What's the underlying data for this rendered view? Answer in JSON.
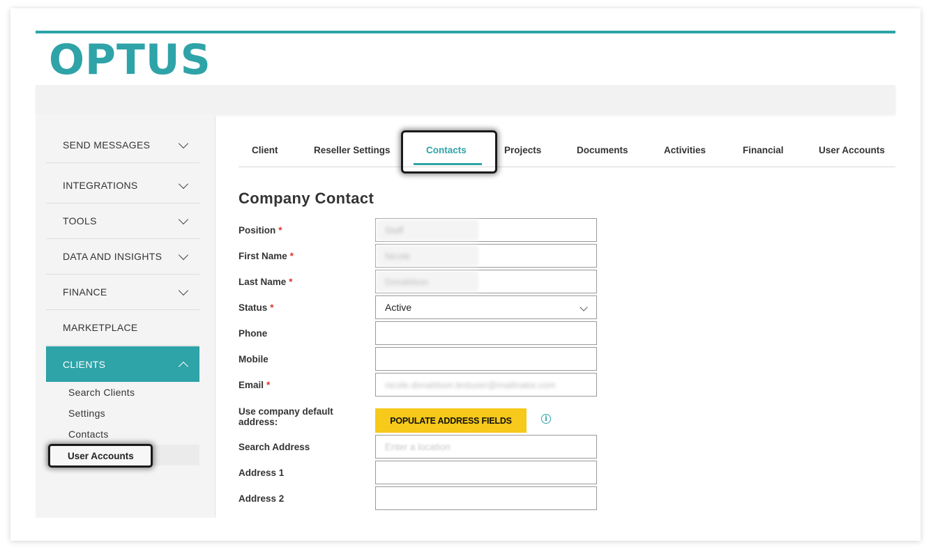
{
  "brand": {
    "logo_text": "OPTUS",
    "accent_color": "#2ea3a8"
  },
  "sidebar": {
    "items": [
      {
        "label": "SEND MESSAGES",
        "icon": "chevron-down-icon"
      },
      {
        "label": "INTEGRATIONS",
        "icon": "chevron-down-icon"
      },
      {
        "label": "TOOLS",
        "icon": "chevron-down-icon"
      },
      {
        "label": "DATA AND INSIGHTS",
        "icon": "chevron-down-icon"
      },
      {
        "label": "FINANCE",
        "icon": "chevron-down-icon"
      },
      {
        "label": "MARKETPLACE"
      },
      {
        "label": "CLIENTS",
        "icon": "chevron-up-icon",
        "active": true
      }
    ],
    "sub_items": [
      "Search Clients",
      "Settings",
      "Contacts",
      "User Accounts"
    ],
    "active_sub_item": "User Accounts"
  },
  "tabs": {
    "items": [
      "Client",
      "Reseller Settings",
      "Contacts",
      "Projects",
      "Documents",
      "Activities",
      "Financial",
      "User Accounts"
    ],
    "active": "Contacts"
  },
  "form": {
    "title": "Company Contact",
    "required_marker": "*",
    "fields": {
      "position": {
        "label": "Position",
        "value": "Staff",
        "redacted": true
      },
      "first_name": {
        "label": "First Name",
        "value": "Nicole",
        "redacted": true
      },
      "last_name": {
        "label": "Last Name",
        "value": "Donaldson",
        "redacted": true
      },
      "status": {
        "label": "Status",
        "value": "Active"
      },
      "phone": {
        "label": "Phone",
        "value": ""
      },
      "mobile": {
        "label": "Mobile",
        "value": ""
      },
      "email": {
        "label": "Email",
        "value": "nicole.donaldson.testuser@mailinator.com",
        "redacted": true
      },
      "use_default_address": {
        "label": "Use company default address:"
      },
      "search_address": {
        "label": "Search Address",
        "placeholder": "Enter a location"
      },
      "address1": {
        "label": "Address 1",
        "value": ""
      },
      "address2": {
        "label": "Address 2",
        "value": ""
      }
    },
    "populate_button": "POPULATE ADDRESS FIELDS",
    "info_icon_glyph": "i",
    "button_color": "#f6c91a",
    "required_color": "#e0312b"
  }
}
